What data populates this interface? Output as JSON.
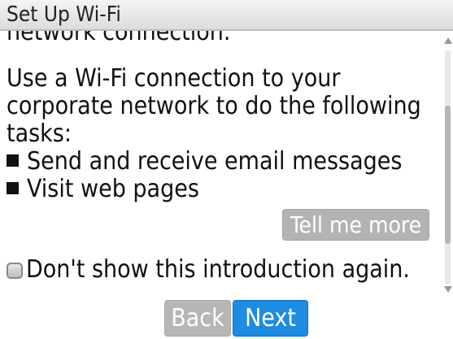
{
  "window": {
    "title": "Set Up Wi-Fi"
  },
  "content": {
    "cut_line": "network connection.",
    "paragraph": "Use a Wi-Fi connection to your corporate network to do the following tasks:",
    "bullets": [
      "Send and receive email messages",
      "Visit web pages"
    ],
    "tell_more_label": "Tell me more",
    "checkbox_label": "Don't show this introduction again."
  },
  "buttons": {
    "back_label": "Back",
    "next_label": "Next"
  },
  "colors": {
    "accent": "#1e8ce0",
    "disabled_button": "#b6b6b6"
  },
  "state": {
    "checkbox_checked": false
  }
}
